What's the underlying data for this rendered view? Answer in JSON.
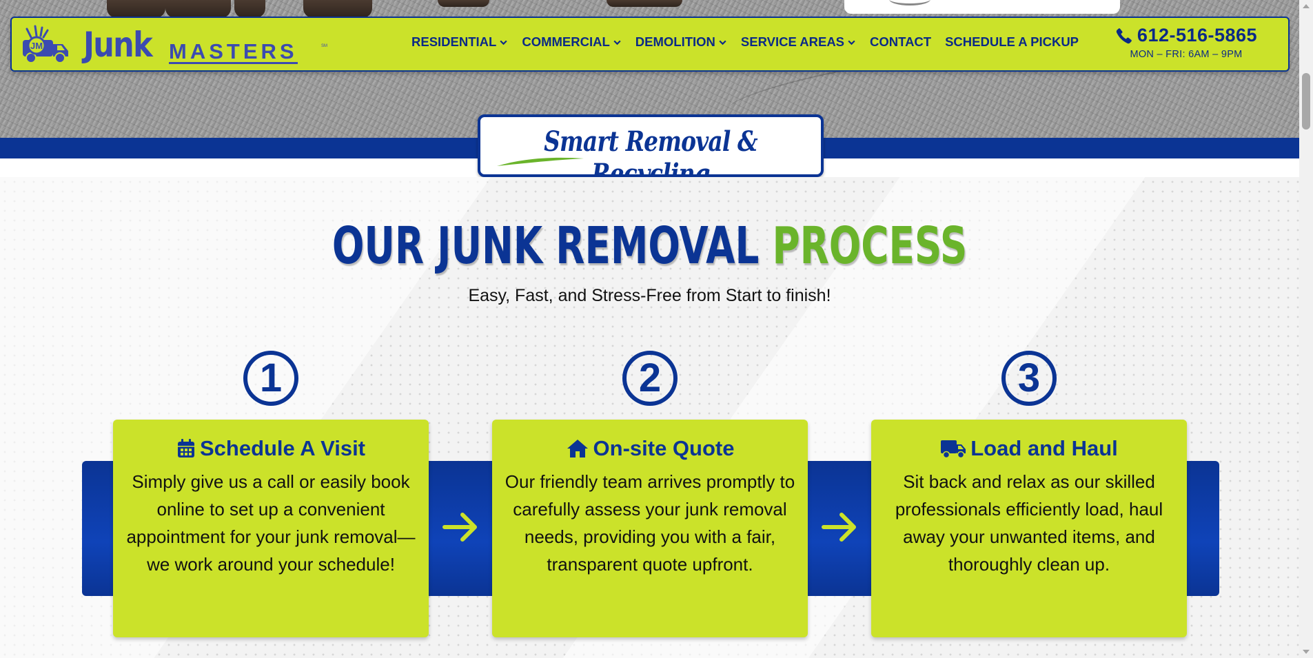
{
  "brand": {
    "name_part1": "Junk",
    "name_part2": "MASTERS",
    "trademark": "SM",
    "logo_icon": "jm-truck-logo-icon"
  },
  "nav": {
    "items": [
      {
        "label": "RESIDENTIAL",
        "has_dropdown": true
      },
      {
        "label": "COMMERCIAL",
        "has_dropdown": true
      },
      {
        "label": "DEMOLITION",
        "has_dropdown": true
      },
      {
        "label": "SERVICE AREAS",
        "has_dropdown": true
      },
      {
        "label": "CONTACT",
        "has_dropdown": false
      },
      {
        "label": "SCHEDULE A PICKUP",
        "has_dropdown": false
      }
    ]
  },
  "contact": {
    "phone": "612-516-5865",
    "hours": "MON – FRI: 6AM – 9PM",
    "icon": "phone-icon"
  },
  "badge": {
    "text": "Smart Removal & Recycling"
  },
  "process": {
    "title_part1": "OUR JUNK REMOVAL",
    "title_part2": "PROCESS",
    "subtitle": "Easy, Fast, and Stress-Free from Start to finish!",
    "steps": [
      {
        "number": "1",
        "icon": "calendar-icon",
        "title": "Schedule A Visit",
        "body": "Simply give us a call or easily book online to set up a convenient appointment for your junk removal—we work around your schedule!"
      },
      {
        "number": "2",
        "icon": "home-icon",
        "title": "On-site Quote",
        "body": "Our friendly team arrives promptly to carefully assess your junk removal needs, providing you with a fair, transparent quote upfront."
      },
      {
        "number": "3",
        "icon": "truck-icon",
        "title": "Load and Haul",
        "body": "Sit back and relax as our skilled professionals efficiently load, haul away your unwanted items, and thoroughly clean up."
      }
    ]
  },
  "colors": {
    "lime": "#cbe22a",
    "navy": "#0b3494",
    "green": "#6ab42b",
    "logo_blue": "#3b4bb0"
  }
}
